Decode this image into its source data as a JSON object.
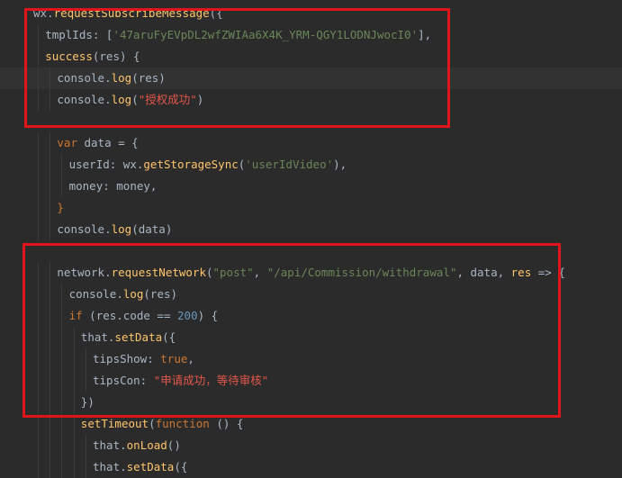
{
  "editor": {
    "lines": [
      {
        "indent": 0,
        "current": false,
        "tokens": [
          {
            "t": "wx.",
            "c": "plain"
          },
          {
            "t": "requestSubscribeMessage",
            "c": "method"
          },
          {
            "t": "({",
            "c": "plain"
          }
        ]
      },
      {
        "indent": 1,
        "current": false,
        "tokens": [
          {
            "t": "tmplIds: [",
            "c": "plain"
          },
          {
            "t": "'47aruFyEVpDL2wfZWIAa6X4K_YRM-QGY1LODNJwocI0'",
            "c": "str"
          },
          {
            "t": "],",
            "c": "plain"
          }
        ]
      },
      {
        "indent": 1,
        "current": false,
        "tokens": [
          {
            "t": "success",
            "c": "method"
          },
          {
            "t": "(res) {",
            "c": "plain"
          }
        ]
      },
      {
        "indent": 2,
        "current": true,
        "tokens": [
          {
            "t": "console.",
            "c": "plain"
          },
          {
            "t": "log",
            "c": "method"
          },
          {
            "t": "(res)",
            "c": "plain"
          }
        ]
      },
      {
        "indent": 2,
        "current": false,
        "tokens": [
          {
            "t": "console.",
            "c": "plain"
          },
          {
            "t": "log",
            "c": "method"
          },
          {
            "t": "(",
            "c": "plain"
          },
          {
            "t": "\"授权成功\"",
            "c": "str-zh"
          },
          {
            "t": ")",
            "c": "plain"
          }
        ]
      },
      {
        "indent": 0,
        "current": false,
        "tokens": []
      },
      {
        "indent": 2,
        "current": false,
        "tokens": [
          {
            "t": "var ",
            "c": "kw"
          },
          {
            "t": "data = {",
            "c": "plain"
          }
        ]
      },
      {
        "indent": 3,
        "current": false,
        "tokens": [
          {
            "t": "userId: wx.",
            "c": "plain"
          },
          {
            "t": "getStorageSync",
            "c": "method"
          },
          {
            "t": "(",
            "c": "plain"
          },
          {
            "t": "'userIdVideo'",
            "c": "str"
          },
          {
            "t": "),",
            "c": "plain"
          }
        ]
      },
      {
        "indent": 3,
        "current": false,
        "tokens": [
          {
            "t": "money: money,",
            "c": "plain"
          }
        ]
      },
      {
        "indent": 2,
        "current": false,
        "tokens": [
          {
            "t": "}",
            "c": "kw"
          }
        ]
      },
      {
        "indent": 2,
        "current": false,
        "tokens": [
          {
            "t": "console.",
            "c": "plain"
          },
          {
            "t": "log",
            "c": "method"
          },
          {
            "t": "(data)",
            "c": "plain"
          }
        ]
      },
      {
        "indent": 0,
        "current": false,
        "tokens": []
      },
      {
        "indent": 2,
        "current": false,
        "tokens": [
          {
            "t": "network.",
            "c": "plain"
          },
          {
            "t": "requestNetwork",
            "c": "method"
          },
          {
            "t": "(",
            "c": "plain"
          },
          {
            "t": "\"post\"",
            "c": "str"
          },
          {
            "t": ", ",
            "c": "plain"
          },
          {
            "t": "\"/api/Commission/withdrawal\"",
            "c": "str"
          },
          {
            "t": ", data, ",
            "c": "plain"
          },
          {
            "t": "res",
            "c": "method"
          },
          {
            "t": " => {",
            "c": "plain"
          }
        ]
      },
      {
        "indent": 3,
        "current": false,
        "tokens": [
          {
            "t": "console.",
            "c": "plain"
          },
          {
            "t": "log",
            "c": "method"
          },
          {
            "t": "(res)",
            "c": "plain"
          }
        ]
      },
      {
        "indent": 3,
        "current": false,
        "tokens": [
          {
            "t": "if ",
            "c": "kw"
          },
          {
            "t": "(res.code == ",
            "c": "plain"
          },
          {
            "t": "200",
            "c": "num"
          },
          {
            "t": ") {",
            "c": "plain"
          }
        ]
      },
      {
        "indent": 4,
        "current": false,
        "tokens": [
          {
            "t": "that.",
            "c": "plain"
          },
          {
            "t": "setData",
            "c": "method"
          },
          {
            "t": "({",
            "c": "plain"
          }
        ]
      },
      {
        "indent": 5,
        "current": false,
        "tokens": [
          {
            "t": "tipsShow: ",
            "c": "plain"
          },
          {
            "t": "true",
            "c": "kw"
          },
          {
            "t": ",",
            "c": "plain"
          }
        ]
      },
      {
        "indent": 5,
        "current": false,
        "tokens": [
          {
            "t": "tipsCon: ",
            "c": "plain"
          },
          {
            "t": "\"申请成功，等待审核\"",
            "c": "str-zh"
          }
        ]
      },
      {
        "indent": 4,
        "current": false,
        "tokens": [
          {
            "t": "})",
            "c": "plain"
          }
        ]
      },
      {
        "indent": 4,
        "current": false,
        "tokens": [
          {
            "t": "setTimeout",
            "c": "method"
          },
          {
            "t": "(",
            "c": "plain"
          },
          {
            "t": "function ",
            "c": "kw"
          },
          {
            "t": "() {",
            "c": "plain"
          }
        ]
      },
      {
        "indent": 5,
        "current": false,
        "tokens": [
          {
            "t": "that.",
            "c": "plain"
          },
          {
            "t": "onLoad",
            "c": "method"
          },
          {
            "t": "()",
            "c": "plain"
          }
        ]
      },
      {
        "indent": 5,
        "current": false,
        "tokens": [
          {
            "t": "that.",
            "c": "plain"
          },
          {
            "t": "setData",
            "c": "method"
          },
          {
            "t": "({",
            "c": "plain"
          }
        ]
      }
    ]
  },
  "highlight_color": "#e1141c"
}
